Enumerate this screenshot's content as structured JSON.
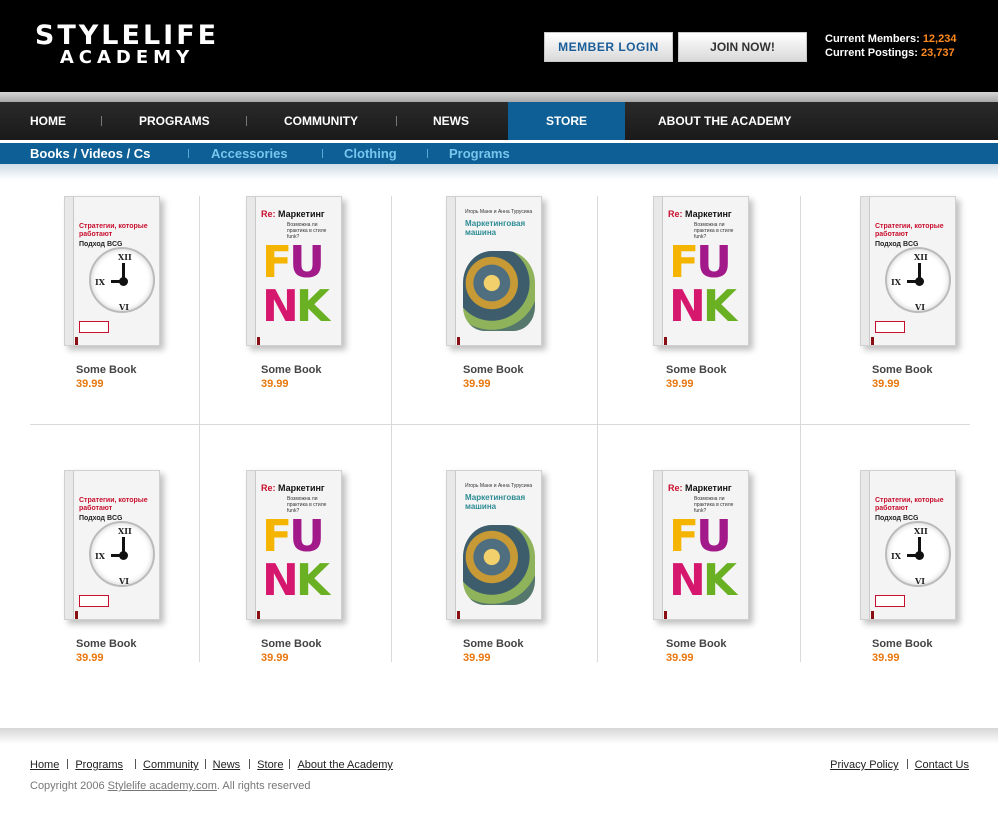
{
  "logo": {
    "line1": "STYLELIFE",
    "line2": "ACADEMY"
  },
  "header": {
    "login_label": "MEMBER  LOGIN",
    "join_label": "JOIN NOW!",
    "members_label": "Current Members:",
    "members_value": "12,234",
    "postings_label": "Current Postings:",
    "postings_value": "23,737",
    "accent_color": "#ff8a1e"
  },
  "main_nav": {
    "items": [
      "HOME",
      "PROGRAMS",
      "COMMUNITY",
      "NEWS",
      "STORE",
      "ABOUT THE ACADEMY"
    ],
    "active": "STORE",
    "active_color": "#0d5f95"
  },
  "sub_nav": {
    "items": [
      "Books / Videos / Cs",
      "Accessories",
      "Clothing",
      "Programs"
    ],
    "active": "Books / Videos / Cs"
  },
  "covers": {
    "strategy": {
      "title": "Стратегии, которые работают",
      "subtitle": "Подход BCG",
      "numerals": [
        "XII",
        "IX",
        "VI"
      ]
    },
    "funk": {
      "prefix": "Re:",
      "title": "Маркетинг",
      "subtitle": "Возможна ли практика в стиле funk?",
      "letters": [
        "F",
        "U",
        "N",
        "K"
      ]
    },
    "marketing": {
      "authors": "Игорь Манн и Анна Турусина",
      "title": "Маркетинговая машина"
    }
  },
  "products": [
    {
      "title": "Some Book",
      "price": "39.99",
      "cover": "strategy"
    },
    {
      "title": "Some Book",
      "price": "39.99",
      "cover": "funk"
    },
    {
      "title": "Some Book",
      "price": "39.99",
      "cover": "marketing"
    },
    {
      "title": "Some Book",
      "price": "39.99",
      "cover": "funk"
    },
    {
      "title": "Some Book",
      "price": "39.99",
      "cover": "strategy"
    },
    {
      "title": "Some Book",
      "price": "39.99",
      "cover": "strategy"
    },
    {
      "title": "Some Book",
      "price": "39.99",
      "cover": "funk"
    },
    {
      "title": "Some Book",
      "price": "39.99",
      "cover": "marketing"
    },
    {
      "title": "Some Book",
      "price": "39.99",
      "cover": "funk"
    },
    {
      "title": "Some Book",
      "price": "39.99",
      "cover": "strategy"
    }
  ],
  "price_color": "#e8770f",
  "footer": {
    "links": [
      "Home",
      "Programs",
      "Community",
      "News",
      "Store",
      "About the Academy"
    ],
    "right_links": [
      "Privacy Policy",
      "Contact Us"
    ],
    "copyright_prefix": "Copyright 2006",
    "copyright_link": "Stylelife academy.com",
    "copyright_suffix": ".  All rights reserved"
  }
}
